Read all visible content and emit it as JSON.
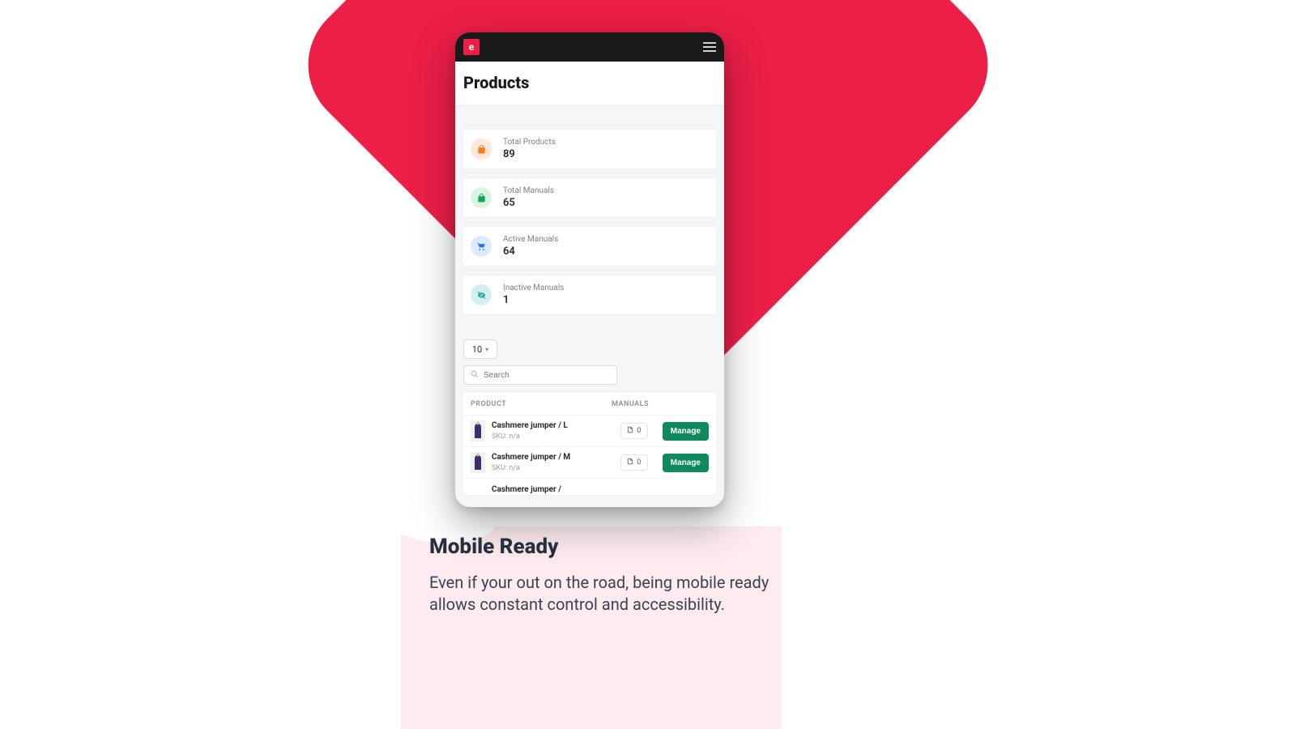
{
  "header": {
    "logo_letter": "e",
    "page_title": "Products"
  },
  "stats": [
    {
      "label": "Total Products",
      "value": "89",
      "icon": "bag-icon",
      "cls": "ic-orange"
    },
    {
      "label": "Total Manuals",
      "value": "65",
      "icon": "bag-icon",
      "cls": "ic-green"
    },
    {
      "label": "Active Manuals",
      "value": "64",
      "icon": "cart-icon",
      "cls": "ic-blue"
    },
    {
      "label": "Inactive Manuals",
      "value": "1",
      "icon": "eye-off-icon",
      "cls": "ic-teal"
    }
  ],
  "controls": {
    "page_size": "10",
    "search_placeholder": "Search"
  },
  "table": {
    "headers": {
      "product": "PRODUCT",
      "manuals": "MANUALS"
    },
    "rows": [
      {
        "title": "Cashmere jumper / L",
        "sku": "SKU: n/a",
        "manuals": "0",
        "action": "Manage"
      },
      {
        "title": "Cashmere jumper / M",
        "sku": "SKU: n/a",
        "manuals": "0",
        "action": "Manage"
      }
    ],
    "partial_row_title": "Cashmere jumper /"
  },
  "marketing": {
    "title": "Mobile Ready",
    "body": "Even if your out on the road, being mobile ready allows constant control and accessibility."
  }
}
